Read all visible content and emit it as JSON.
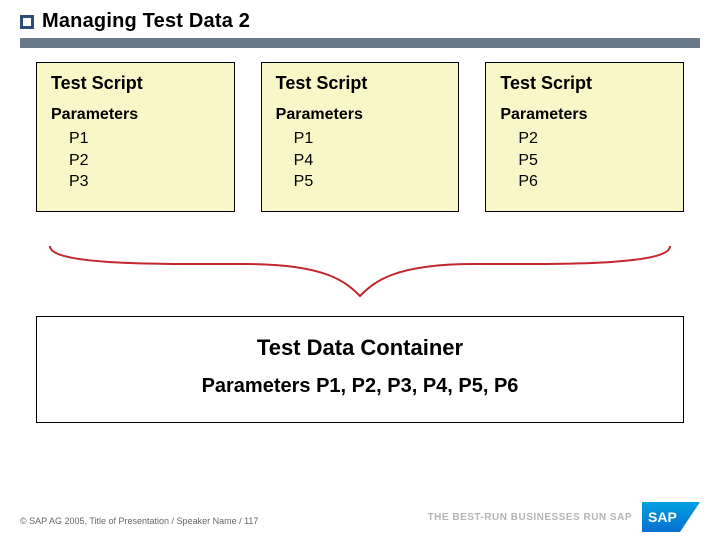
{
  "title": "Managing Test Data 2",
  "scripts": [
    {
      "heading": "Test Script",
      "params_label": "Parameters",
      "params": [
        "P1",
        "P2",
        "P3"
      ]
    },
    {
      "heading": "Test Script",
      "params_label": "Parameters",
      "params": [
        "P1",
        "P4",
        "P5"
      ]
    },
    {
      "heading": "Test Script",
      "params_label": "Parameters",
      "params": [
        "P2",
        "P5",
        "P6"
      ]
    }
  ],
  "container": {
    "heading": "Test Data Container",
    "params_line": "Parameters P1, P2, P3, P4, P5, P6"
  },
  "footer": {
    "copyright": "© SAP AG 2005, Title of Presentation / Speaker Name / 117",
    "tagline": "THE BEST-RUN BUSINESSES RUN SAP",
    "logo_text": "SAP"
  },
  "colors": {
    "card_bg": "#f9f6c7",
    "divider": "#6a7a8a",
    "brace": "#c1272d",
    "title_square_border": "#2d4d78",
    "sap_blue": "#0a6ed1",
    "sap_gradient_end": "#00a1e0"
  }
}
